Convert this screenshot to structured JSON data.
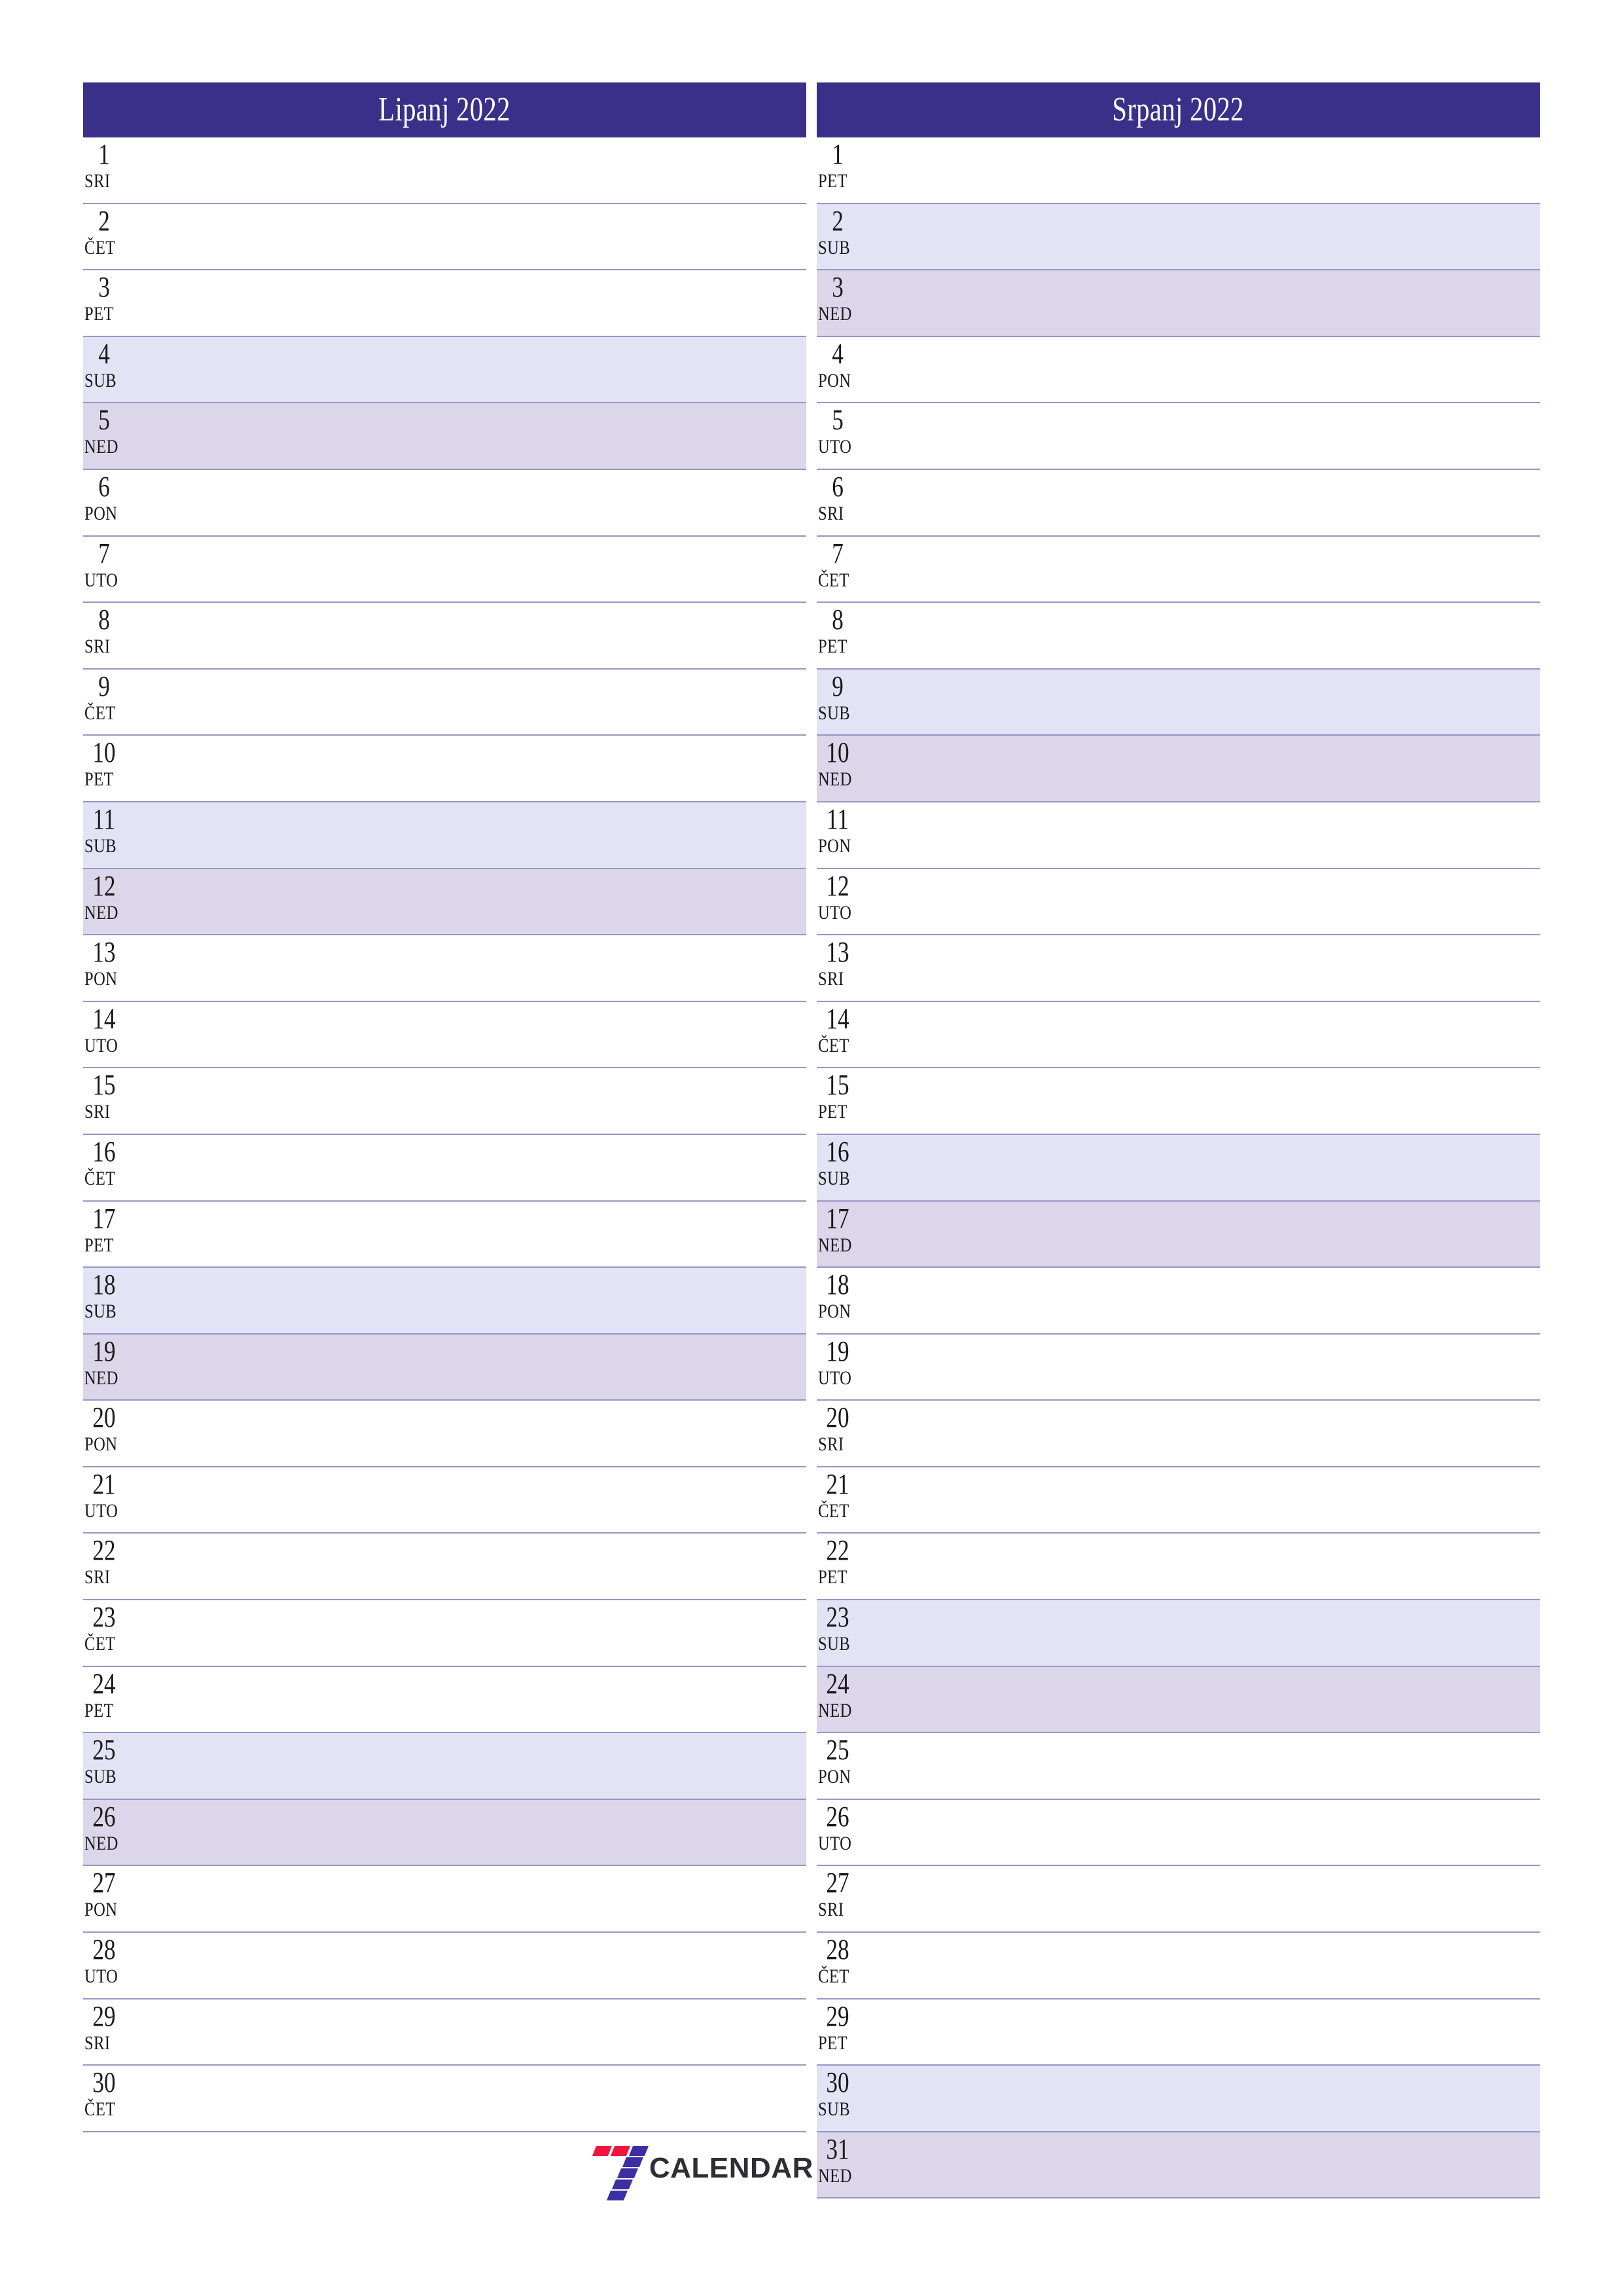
{
  "brand": {
    "name": "CALENDAR",
    "mark": "seven-logo-icon",
    "mark_colors": [
      "#f3133f",
      "#3c2fa4"
    ]
  },
  "theme": {
    "header_bg": "#3b3089",
    "header_text": "#ffffff",
    "saturday_bg": "#e3e3f6",
    "sunday_bg": "#dbd6e9",
    "row_border": "#9a94c4",
    "day_text": "#1a1a1a",
    "page_bg": "#ffffff"
  },
  "months": [
    {
      "title": "Lipanj 2022",
      "days": [
        {
          "num": "1",
          "weekday": "SRI",
          "type": "weekday"
        },
        {
          "num": "2",
          "weekday": "ČET",
          "type": "weekday"
        },
        {
          "num": "3",
          "weekday": "PET",
          "type": "weekday"
        },
        {
          "num": "4",
          "weekday": "SUB",
          "type": "saturday"
        },
        {
          "num": "5",
          "weekday": "NED",
          "type": "sunday"
        },
        {
          "num": "6",
          "weekday": "PON",
          "type": "weekday"
        },
        {
          "num": "7",
          "weekday": "UTO",
          "type": "weekday"
        },
        {
          "num": "8",
          "weekday": "SRI",
          "type": "weekday"
        },
        {
          "num": "9",
          "weekday": "ČET",
          "type": "weekday"
        },
        {
          "num": "10",
          "weekday": "PET",
          "type": "weekday"
        },
        {
          "num": "11",
          "weekday": "SUB",
          "type": "saturday"
        },
        {
          "num": "12",
          "weekday": "NED",
          "type": "sunday"
        },
        {
          "num": "13",
          "weekday": "PON",
          "type": "weekday"
        },
        {
          "num": "14",
          "weekday": "UTO",
          "type": "weekday"
        },
        {
          "num": "15",
          "weekday": "SRI",
          "type": "weekday"
        },
        {
          "num": "16",
          "weekday": "ČET",
          "type": "weekday"
        },
        {
          "num": "17",
          "weekday": "PET",
          "type": "weekday"
        },
        {
          "num": "18",
          "weekday": "SUB",
          "type": "saturday"
        },
        {
          "num": "19",
          "weekday": "NED",
          "type": "sunday"
        },
        {
          "num": "20",
          "weekday": "PON",
          "type": "weekday"
        },
        {
          "num": "21",
          "weekday": "UTO",
          "type": "weekday"
        },
        {
          "num": "22",
          "weekday": "SRI",
          "type": "weekday"
        },
        {
          "num": "23",
          "weekday": "ČET",
          "type": "weekday"
        },
        {
          "num": "24",
          "weekday": "PET",
          "type": "weekday"
        },
        {
          "num": "25",
          "weekday": "SUB",
          "type": "saturday"
        },
        {
          "num": "26",
          "weekday": "NED",
          "type": "sunday"
        },
        {
          "num": "27",
          "weekday": "PON",
          "type": "weekday"
        },
        {
          "num": "28",
          "weekday": "UTO",
          "type": "weekday"
        },
        {
          "num": "29",
          "weekday": "SRI",
          "type": "weekday"
        },
        {
          "num": "30",
          "weekday": "ČET",
          "type": "weekday"
        }
      ]
    },
    {
      "title": "Srpanj 2022",
      "days": [
        {
          "num": "1",
          "weekday": "PET",
          "type": "weekday"
        },
        {
          "num": "2",
          "weekday": "SUB",
          "type": "saturday"
        },
        {
          "num": "3",
          "weekday": "NED",
          "type": "sunday"
        },
        {
          "num": "4",
          "weekday": "PON",
          "type": "weekday"
        },
        {
          "num": "5",
          "weekday": "UTO",
          "type": "weekday"
        },
        {
          "num": "6",
          "weekday": "SRI",
          "type": "weekday"
        },
        {
          "num": "7",
          "weekday": "ČET",
          "type": "weekday"
        },
        {
          "num": "8",
          "weekday": "PET",
          "type": "weekday"
        },
        {
          "num": "9",
          "weekday": "SUB",
          "type": "saturday"
        },
        {
          "num": "10",
          "weekday": "NED",
          "type": "sunday"
        },
        {
          "num": "11",
          "weekday": "PON",
          "type": "weekday"
        },
        {
          "num": "12",
          "weekday": "UTO",
          "type": "weekday"
        },
        {
          "num": "13",
          "weekday": "SRI",
          "type": "weekday"
        },
        {
          "num": "14",
          "weekday": "ČET",
          "type": "weekday"
        },
        {
          "num": "15",
          "weekday": "PET",
          "type": "weekday"
        },
        {
          "num": "16",
          "weekday": "SUB",
          "type": "saturday"
        },
        {
          "num": "17",
          "weekday": "NED",
          "type": "sunday"
        },
        {
          "num": "18",
          "weekday": "PON",
          "type": "weekday"
        },
        {
          "num": "19",
          "weekday": "UTO",
          "type": "weekday"
        },
        {
          "num": "20",
          "weekday": "SRI",
          "type": "weekday"
        },
        {
          "num": "21",
          "weekday": "ČET",
          "type": "weekday"
        },
        {
          "num": "22",
          "weekday": "PET",
          "type": "weekday"
        },
        {
          "num": "23",
          "weekday": "SUB",
          "type": "saturday"
        },
        {
          "num": "24",
          "weekday": "NED",
          "type": "sunday"
        },
        {
          "num": "25",
          "weekday": "PON",
          "type": "weekday"
        },
        {
          "num": "26",
          "weekday": "UTO",
          "type": "weekday"
        },
        {
          "num": "27",
          "weekday": "SRI",
          "type": "weekday"
        },
        {
          "num": "28",
          "weekday": "ČET",
          "type": "weekday"
        },
        {
          "num": "29",
          "weekday": "PET",
          "type": "weekday"
        },
        {
          "num": "30",
          "weekday": "SUB",
          "type": "saturday"
        },
        {
          "num": "31",
          "weekday": "NED",
          "type": "sunday"
        }
      ]
    }
  ]
}
